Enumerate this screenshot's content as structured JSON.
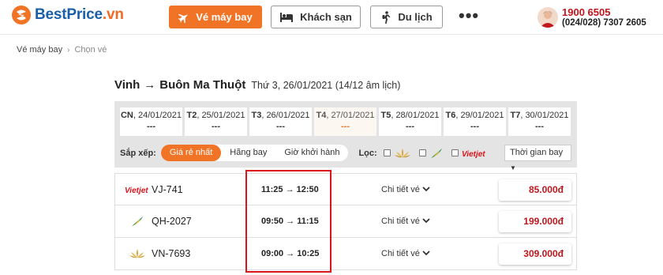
{
  "brand": {
    "name_a": "BestPrice",
    "name_b": ".vn",
    "accent": "#f07326",
    "blue": "#1b5fa8",
    "red": "#c0171d"
  },
  "nav": {
    "flight_label": "Vé máy bay",
    "hotel_label": "Khách sạn",
    "tour_label": "Du lịch",
    "more_label": "•••"
  },
  "contact": {
    "hotline": "1900 6505",
    "phone": "(024/028) 7307 2605"
  },
  "breadcrumb": {
    "home": "Vé máy bay",
    "current": "Chọn vé"
  },
  "route": {
    "from": "Vinh",
    "arrow": "→",
    "to": "Buôn Ma Thuột",
    "date": "Thứ 3, 26/01/2021 (14/12 âm lịch)"
  },
  "days": [
    {
      "dow": "CN",
      "date": ", 24/01/2021",
      "price": "---",
      "active": false
    },
    {
      "dow": "T2",
      "date": ", 25/01/2021",
      "price": "---",
      "active": false
    },
    {
      "dow": "T3",
      "date": ", 26/01/2021",
      "price": "---",
      "active": false
    },
    {
      "dow": "T4",
      "date": ", 27/01/2021",
      "price": "---",
      "active": true
    },
    {
      "dow": "T5",
      "date": ", 28/01/2021",
      "price": "---",
      "active": false
    },
    {
      "dow": "T6",
      "date": ", 29/01/2021",
      "price": "---",
      "active": false
    },
    {
      "dow": "T7",
      "date": ", 30/01/2021",
      "price": "---",
      "active": false
    }
  ],
  "sort": {
    "label": "Sắp xếp:",
    "options": [
      "Giá rẻ nhất",
      "Hãng bay",
      "Giờ khởi hành"
    ],
    "selected": "Giá rẻ nhất"
  },
  "filter": {
    "label": "Lọc:",
    "airlines": [
      "vietnam-airlines-lotus-icon",
      "bamboo-airways-icon",
      "vietjet-logo"
    ],
    "vietjet_text": "Vietjet",
    "time_label": "Thời gian bay"
  },
  "flights": [
    {
      "airline": "vietjet-logo",
      "airline_text": "Vietjet",
      "code": "VJ-741",
      "depart": "11:25",
      "arrive": "12:50",
      "detail": "Chi tiết vé",
      "price": "85.000đ"
    },
    {
      "airline": "bamboo-airways-icon",
      "airline_text": "",
      "code": "QH-2027",
      "depart": "09:50",
      "arrive": "11:15",
      "detail": "Chi tiết vé",
      "price": "199.000đ"
    },
    {
      "airline": "vietnam-airlines-lotus-icon",
      "airline_text": "",
      "code": "VN-7693",
      "depart": "09:00",
      "arrive": "10:25",
      "detail": "Chi tiết vé",
      "price": "309.000đ"
    }
  ],
  "time_arrow": "→"
}
